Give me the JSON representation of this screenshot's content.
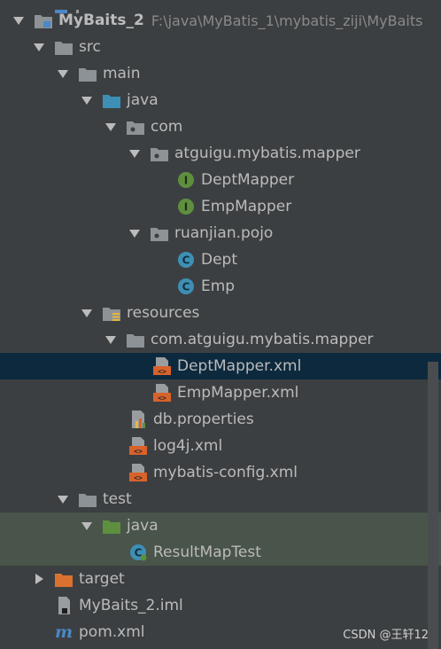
{
  "project": {
    "name": "MyBaits_2",
    "path": "F:\\java\\MyBatis_1\\mybatis_ziji\\MyBaits"
  },
  "tree": {
    "src": "src",
    "main": "main",
    "java_main": "java",
    "com": "com",
    "mapper_pkg": "atguigu.mybatis.mapper",
    "dept_mapper": "DeptMapper",
    "emp_mapper": "EmpMapper",
    "pojo_pkg": "ruanjian.pojo",
    "dept": "Dept",
    "emp": "Emp",
    "resources": "resources",
    "res_mapper_pkg": "com.atguigu.mybatis.mapper",
    "dept_mapper_xml": "DeptMapper.xml",
    "emp_mapper_xml": "EmpMapper.xml",
    "db_properties": "db.properties",
    "log4j_xml": "log4j.xml",
    "mybatis_config_xml": "mybatis-config.xml",
    "test": "test",
    "java_test": "java",
    "result_map_test": "ResultMapTest",
    "target": "target",
    "iml": "MyBaits_2.iml",
    "pom": "pom.xml"
  },
  "watermark": "CSDN @王轩12",
  "colors": {
    "background": "#3c3f41",
    "selected": "#0d293e",
    "test_highlight": "#49544a",
    "interface_icon": "#5e8f3e",
    "class_icon": "#3d8fb5",
    "xml_icon": "#d9622b",
    "target_folder": "#d9722e"
  }
}
